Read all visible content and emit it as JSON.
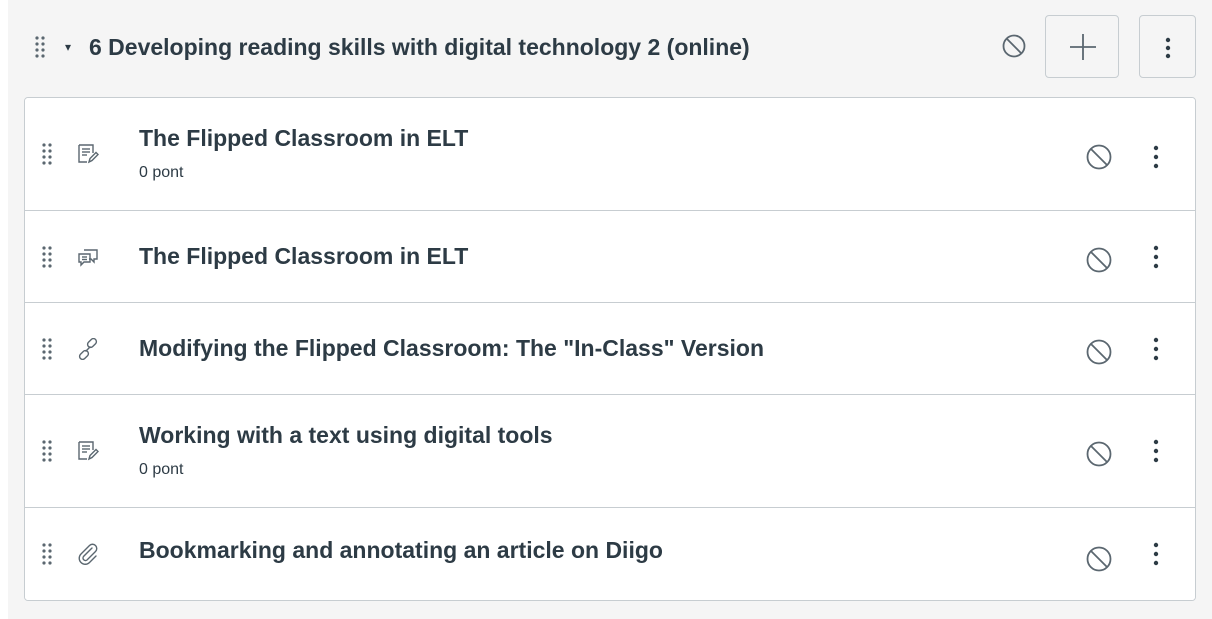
{
  "module": {
    "title": "6 Developing reading skills with digital technology 2 (online)",
    "caret_glyph": "▾"
  },
  "items": [
    {
      "title": "The Flipped Classroom in ELT",
      "points": "0 pont",
      "type_icon": "assignment-icon"
    },
    {
      "title": "The Flipped Classroom in ELT",
      "points": "",
      "type_icon": "discussion-icon"
    },
    {
      "title": "Modifying the Flipped Classroom: The \"In-Class\" Version",
      "points": "",
      "type_icon": "link-icon"
    },
    {
      "title": "Working with a text using digital tools",
      "points": "0 pont",
      "type_icon": "assignment-icon"
    },
    {
      "title": "Bookmarking and annotating an article on Diigo",
      "points": "",
      "type_icon": "attachment-icon"
    }
  ],
  "colors": {
    "text": "#2d3b45",
    "icon": "#5b6770",
    "border": "#c7cdd1",
    "header_bg": "#f5f5f5"
  }
}
